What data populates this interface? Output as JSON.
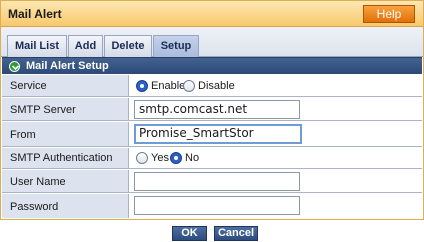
{
  "window": {
    "title": "Mail Alert",
    "help_label": "Help"
  },
  "tabs": [
    {
      "label": "Mail List",
      "active": false
    },
    {
      "label": "Add",
      "active": false
    },
    {
      "label": "Delete",
      "active": false
    },
    {
      "label": "Setup",
      "active": true
    }
  ],
  "section": {
    "title": "Mail Alert Setup",
    "icon": "collapse-chevron-icon"
  },
  "form": {
    "service": {
      "label": "Service",
      "options": [
        "Enable",
        "Disable"
      ],
      "selected": "Enable"
    },
    "smtp_server": {
      "label": "SMTP Server",
      "value": "smtp.comcast.net"
    },
    "from": {
      "label": "From",
      "value": "Promise_SmartStor"
    },
    "smtp_auth": {
      "label": "SMTP Authentication",
      "options": [
        "Yes",
        "No"
      ],
      "selected": "No"
    },
    "user_name": {
      "label": "User Name",
      "value": ""
    },
    "password": {
      "label": "Password",
      "value": ""
    }
  },
  "buttons": {
    "ok_label": "OK",
    "cancel_label": "Cancel"
  },
  "colors": {
    "titlebar": "#f8c96c",
    "help_button": "#e26f07",
    "section_header": "#2d4a77",
    "label_cell": "#dde3ee",
    "action_button": "#2c4b7f"
  }
}
